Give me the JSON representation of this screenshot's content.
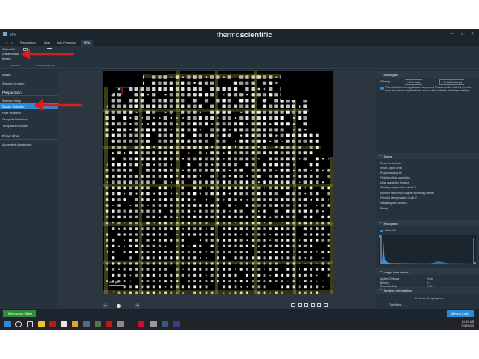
{
  "window": {
    "app_title": "EPU",
    "brand_light": "thermo",
    "brand_bold": "scientific"
  },
  "menu": {
    "tabs": [
      "Preparation",
      "Atlas",
      "Auto Functions",
      "EPU"
    ],
    "active": "EPU"
  },
  "toolbar": {
    "items": [
      "Select All",
      "Unselect All",
      "Invert"
    ],
    "footer_tabs": [
      "Selection",
      "Processing Order"
    ]
  },
  "left_nav": {
    "start": {
      "header": "Start",
      "items": [
        "Session Creation"
      ]
    },
    "preparation": {
      "header": "Preparation",
      "items": [
        "Session Setup",
        "Square Selection",
        "Hole Selection",
        "Template Definition",
        "Template Execution"
      ],
      "active": "Square Selection"
    },
    "execution": {
      "header": "Execution",
      "items": [
        "Automated Acquisition"
      ]
    }
  },
  "viewer": {
    "scale_bar": "200 µm"
  },
  "messages": {
    "header": "Messages",
    "filtering_label": "Filtering:",
    "error_badge": "0 Error(s)",
    "notification_badge": "1 Notification(s)",
    "notification_text": "This calibration is magnification dependent. Please confirm that the presets have the correct magnifications for your data collection before proceeding."
  },
  "status": {
    "header": "Status",
    "lines": [
      "Reset the defocus",
      "Reset Optics Shifts",
      "Postprocessing tile",
      "Finalizing Atlas acquisition",
      "Atlas acquisition finished",
      "Starting categorization of slot 2",
      "No more slots left to acquire, screening finished",
      "Finished categorization of slot 2",
      "Initializing new session...",
      "Ready!"
    ]
  },
  "histogram": {
    "header": "Histogram",
    "auto_filter": "Auto Filter"
  },
  "image_info": {
    "header": "Image Information",
    "rows": [
      {
        "k": "Applied Defocus",
        "v": "0 nm"
      },
      {
        "k": "Binning",
        "v": "1 x"
      },
      {
        "k": "Exposure Time",
        "v": "1.00 s"
      },
      {
        "k": "Image Size",
        "v": "4005 × 4005"
      },
      {
        "k": "Pixel Size",
        "v": "536.87 nm"
      },
      {
        "k": "Field Of View",
        "v": "2.14 mm"
      },
      {
        "k": "Maximum",
        "v": "2914"
      },
      {
        "k": "Mean",
        "v": "608.63"
      },
      {
        "k": "Minimum",
        "v": "0"
      }
    ]
  },
  "session_info": {
    "header": "Session Information",
    "holes": "0 holes / 0 exposures",
    "total_time": "Total time: -"
  },
  "statusbar": {
    "microscope_state": "Microscope State",
    "login": "Athena Login"
  },
  "taskbar": {
    "time": "10:20 AM",
    "date": "7/18/2024"
  },
  "colors": {
    "accent": "#2a8cd8",
    "grid_line": "#c9c84a",
    "arrow": "#d91c1c",
    "state_green": "#2e8b3c"
  }
}
